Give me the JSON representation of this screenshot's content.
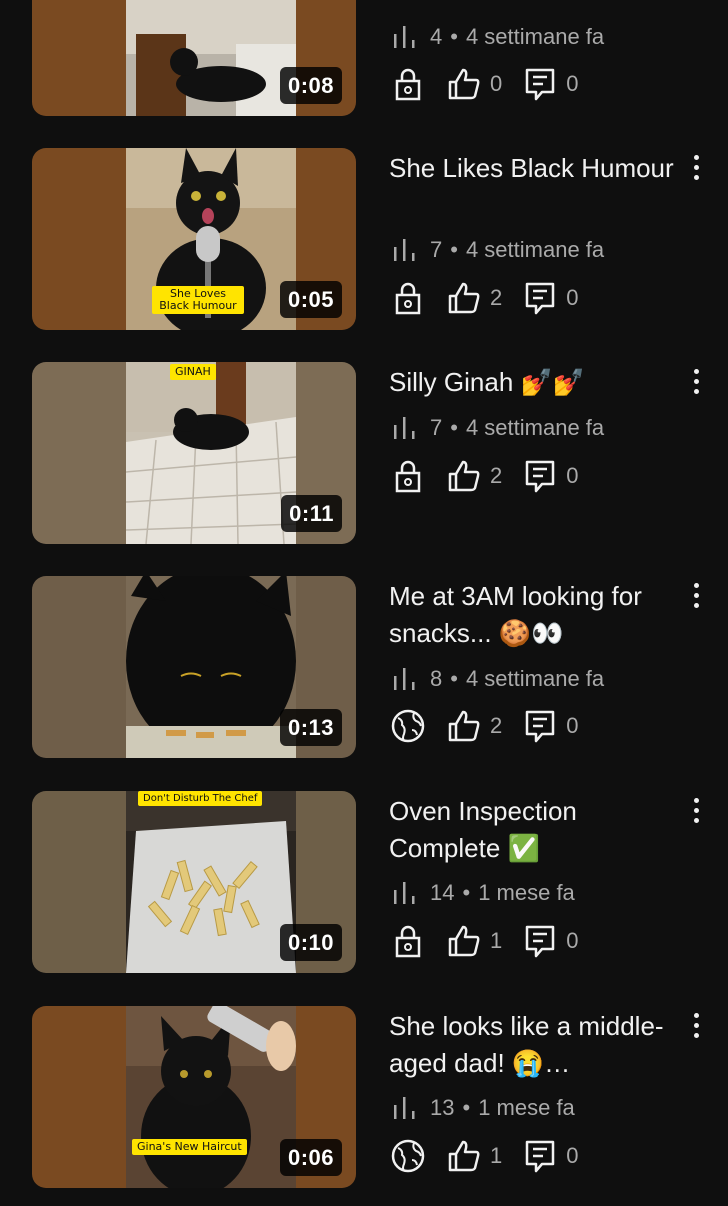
{
  "videos": [
    {
      "title": "",
      "duration": "0:08",
      "views": "4",
      "age": "4 settimane fa",
      "visibility": "private",
      "likes": "0",
      "comments": "0",
      "caption": "",
      "bg": "#7a4a21"
    },
    {
      "title": "She Likes Black Humour",
      "duration": "0:05",
      "views": "7",
      "age": "4 settimane fa",
      "visibility": "private",
      "likes": "2",
      "comments": "0",
      "caption": "She Loves Black Humour",
      "bg": "#7a4a21"
    },
    {
      "title": "Silly Ginah 💅💅",
      "duration": "0:11",
      "views": "7",
      "age": "4 settimane fa",
      "visibility": "private",
      "likes": "2",
      "comments": "0",
      "caption": "GINAH",
      "bg": "#7d6c55"
    },
    {
      "title": "Me at 3AM looking for snacks... 🍪👀",
      "duration": "0:13",
      "views": "8",
      "age": "4 settimane fa",
      "visibility": "public",
      "likes": "2",
      "comments": "0",
      "caption": "",
      "bg": "#6f5e49"
    },
    {
      "title": "Oven Inspection Complete ✅",
      "duration": "0:10",
      "views": "14",
      "age": "1 mese fa",
      "visibility": "private",
      "likes": "1",
      "comments": "0",
      "caption": "Don't Disturb The Chef",
      "bg": "#6e5f48"
    },
    {
      "title": "She looks like a middle-aged dad! 😭…",
      "duration": "0:06",
      "views": "13",
      "age": "1 mese fa",
      "visibility": "public",
      "likes": "1",
      "comments": "0",
      "caption": "Gina's New Haircut",
      "bg": "#7a4a21"
    }
  ],
  "separator": "•"
}
